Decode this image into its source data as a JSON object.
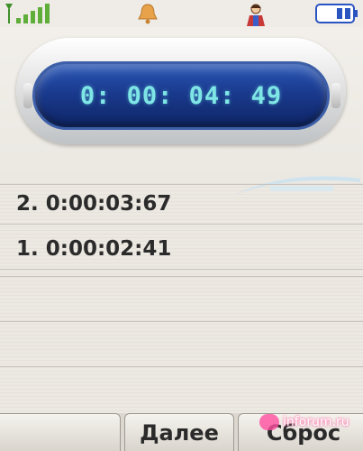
{
  "status_bar": {
    "signal_icon": "signal-bars-icon",
    "alarm_icon": "bell-icon",
    "profile_icon": "person-icon",
    "battery_icon": "battery-icon"
  },
  "stopwatch": {
    "current_time": "0: 00: 04: 49"
  },
  "laps": [
    {
      "label": "2. 0:00:03:67"
    },
    {
      "label": "1. 0:00:02:41"
    }
  ],
  "softkeys": {
    "left": "",
    "middle": "Далее",
    "right": "Сброс"
  },
  "watermark": {
    "text": "inforum.ru"
  },
  "colors": {
    "display_text": "#7fe6e6",
    "display_bg": "#1a3a8e",
    "signal": "#5fae3a",
    "battery": "#2a54c0"
  }
}
